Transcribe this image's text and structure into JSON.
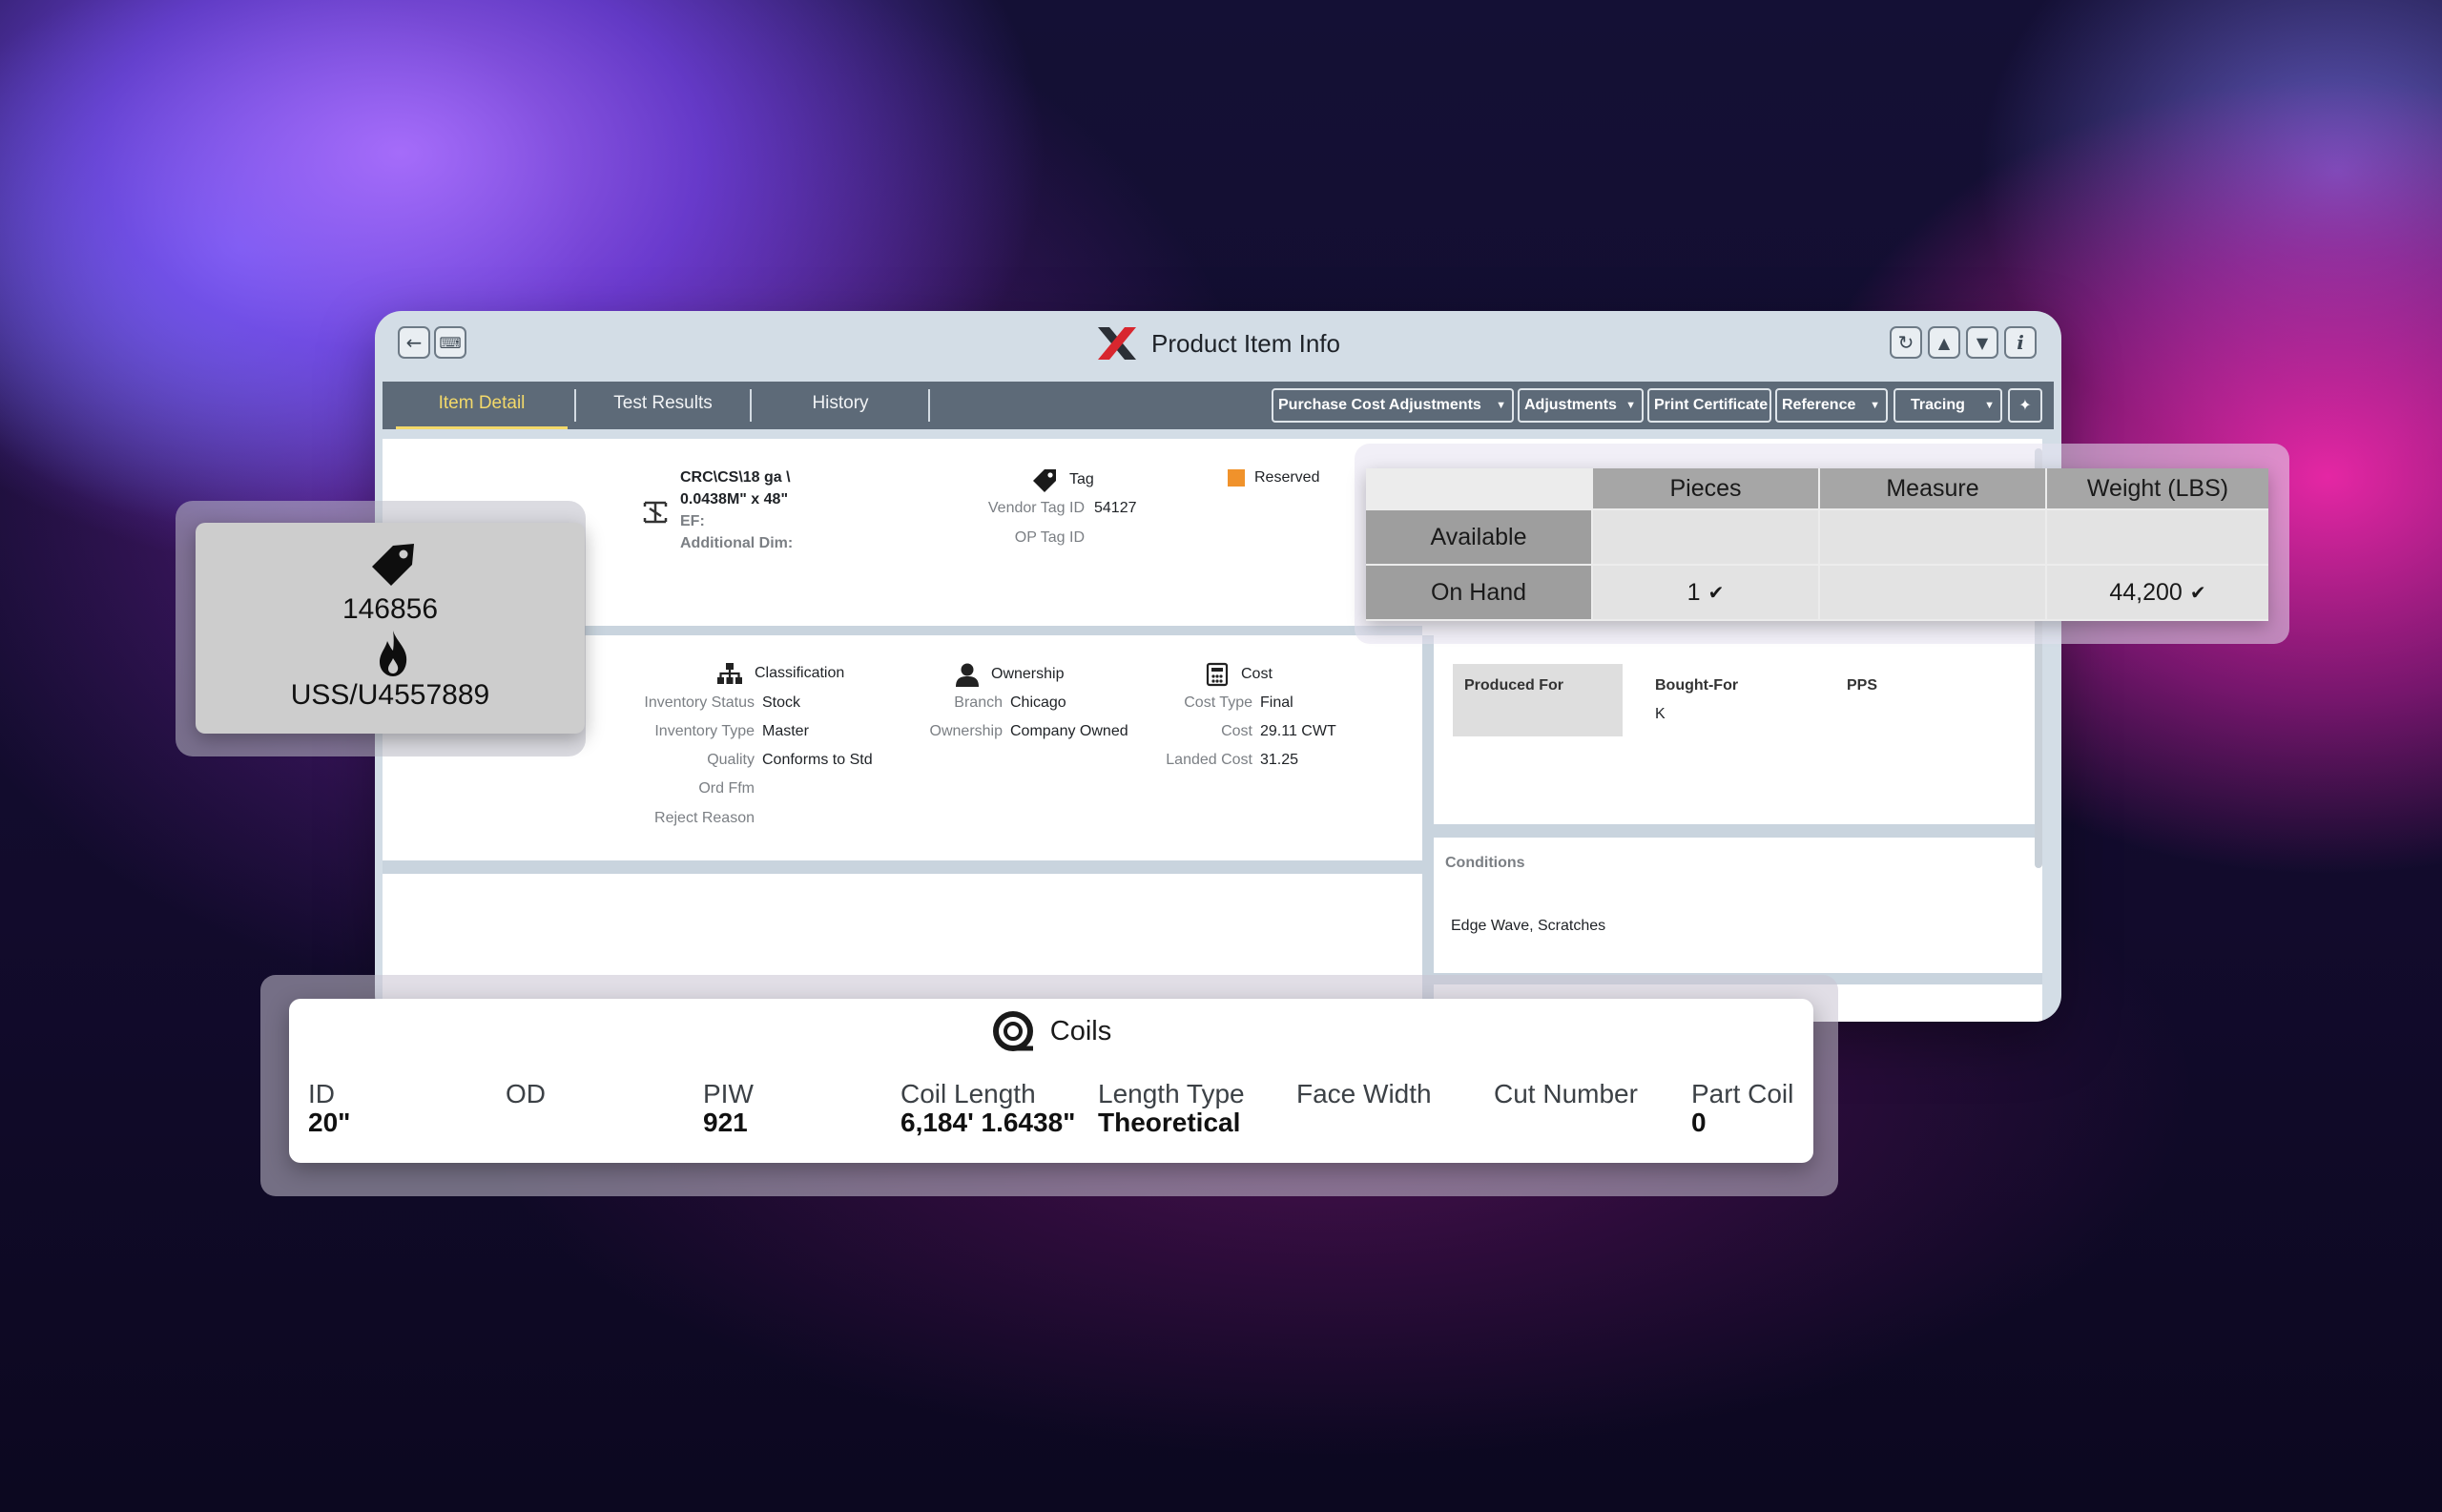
{
  "window": {
    "title": "Product Item Info",
    "left_buttons": [
      "back-arrow",
      "keyboard"
    ],
    "right_buttons": [
      "refresh",
      "up",
      "down",
      "info"
    ]
  },
  "tabs": [
    {
      "label": "Item Detail",
      "active": true
    },
    {
      "label": "Test Results",
      "active": false
    },
    {
      "label": "History",
      "active": false
    }
  ],
  "toolbar": {
    "purchase_cost": "Purchase Cost Adjustments",
    "adjustments": "Adjustments",
    "print_certificate": "Print Certificate",
    "reference": "Reference",
    "tracing": "Tracing"
  },
  "product": {
    "line1": "CRC\\CS\\18 ga \\",
    "line2": "0.0438M\" x 48\"",
    "ef_label": "EF:",
    "additional_dim_label": "Additional Dim:"
  },
  "tag": {
    "header": "Tag",
    "vendor_tag_label": "Vendor Tag ID",
    "vendor_tag_value": "54127",
    "op_tag_label": "OP Tag ID",
    "op_tag_value": "",
    "status": "Reserved",
    "status_color": "#f0922b"
  },
  "classification": {
    "header": "Classification",
    "fields": [
      {
        "label": "Inventory Status",
        "value": "Stock"
      },
      {
        "label": "Inventory Type",
        "value": "Master"
      },
      {
        "label": "Quality",
        "value": "Conforms to Std"
      },
      {
        "label": "Ord Ffm",
        "value": ""
      },
      {
        "label": "Reject Reason",
        "value": ""
      }
    ]
  },
  "ownership": {
    "header": "Ownership",
    "fields": [
      {
        "label": "Branch",
        "value": "Chicago"
      },
      {
        "label": "Ownership",
        "value": "Company Owned"
      }
    ]
  },
  "cost": {
    "header": "Cost",
    "fields": [
      {
        "label": "Cost Type",
        "value": "Final"
      },
      {
        "label": "Cost",
        "value": "29.11 CWT"
      },
      {
        "label": "Landed Cost",
        "value": "31.25"
      }
    ]
  },
  "produced": {
    "produced_for": "Produced For",
    "bought_for": "Bought-For",
    "bought_for_value": "K",
    "pps": "PPS"
  },
  "conditions": {
    "header": "Conditions",
    "value": "Edge Wave, Scratches"
  },
  "tag_card": {
    "tag_number": "146856",
    "heat_number": "USS/U4557889"
  },
  "quantities": {
    "columns": [
      "Pieces",
      "Measure",
      "Weight (LBS)"
    ],
    "rows": [
      {
        "label": "Available",
        "pieces": "",
        "measure": "",
        "weight": ""
      },
      {
        "label": "On Hand",
        "pieces": "1",
        "measure": "",
        "weight": "44,200"
      }
    ]
  },
  "coils": {
    "title": "Coils",
    "columns": [
      {
        "label": "ID",
        "value": "20\""
      },
      {
        "label": "OD",
        "value": ""
      },
      {
        "label": "PIW",
        "value": "921"
      },
      {
        "label": "Coil Length",
        "value": "6,184' 1.6438\""
      },
      {
        "label": "Length Type",
        "value": "Theoretical"
      },
      {
        "label": "Face Width",
        "value": ""
      },
      {
        "label": "Cut Number",
        "value": ""
      },
      {
        "label": "Part Coil",
        "value": "0"
      }
    ]
  }
}
